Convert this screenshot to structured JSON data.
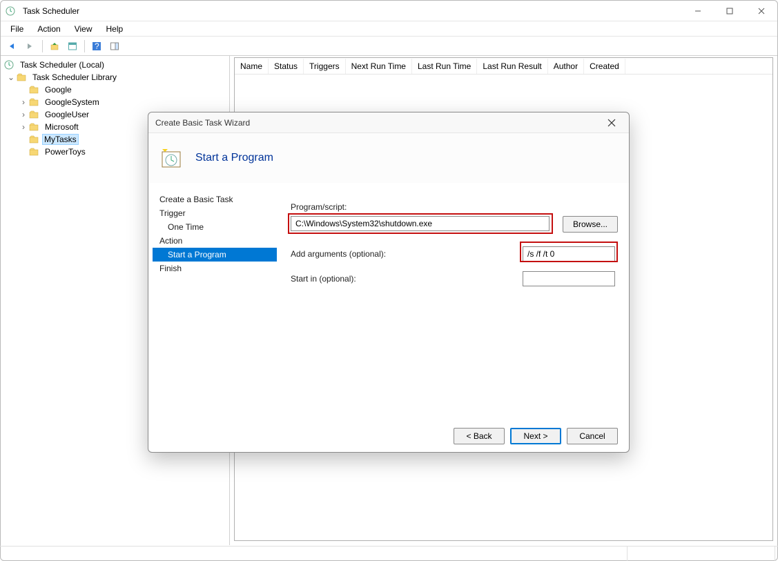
{
  "window": {
    "title": "Task Scheduler"
  },
  "menu": {
    "file": "File",
    "action": "Action",
    "view": "View",
    "help": "Help"
  },
  "tree": {
    "root": "Task Scheduler (Local)",
    "lib": "Task Scheduler Library",
    "items": [
      {
        "label": "Google",
        "expandable": false
      },
      {
        "label": "GoogleSystem",
        "expandable": true
      },
      {
        "label": "GoogleUser",
        "expandable": true
      },
      {
        "label": "Microsoft",
        "expandable": true
      },
      {
        "label": "MyTasks",
        "expandable": false,
        "selected": true
      },
      {
        "label": "PowerToys",
        "expandable": false
      }
    ]
  },
  "columns": [
    "Name",
    "Status",
    "Triggers",
    "Next Run Time",
    "Last Run Time",
    "Last Run Result",
    "Author",
    "Created"
  ],
  "wizard": {
    "dialog_title": "Create Basic Task Wizard",
    "header_title": "Start a Program",
    "nav": {
      "create": "Create a Basic Task",
      "trigger": "Trigger",
      "trigger_sub": "One Time",
      "action": "Action",
      "action_sub": "Start a Program",
      "finish": "Finish"
    },
    "form": {
      "program_label": "Program/script:",
      "program_value": "C:\\Windows\\System32\\shutdown.exe",
      "browse": "Browse...",
      "args_label": "Add arguments (optional):",
      "args_value": "/s /f /t 0",
      "startin_label": "Start in (optional):",
      "startin_value": ""
    },
    "buttons": {
      "back": "< Back",
      "next": "Next >",
      "cancel": "Cancel"
    }
  }
}
